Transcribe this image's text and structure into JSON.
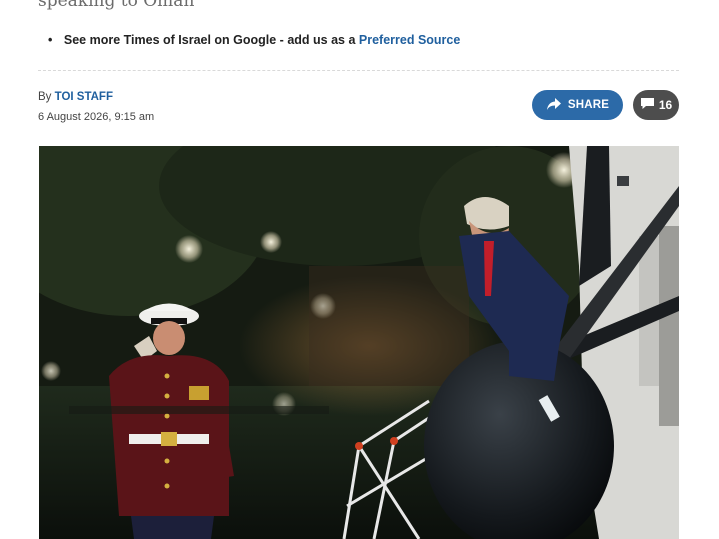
{
  "article": {
    "headline_tail": "speaking to Oman",
    "google_note": {
      "prefix": "See more Times of Israel on Google - add us as a",
      "link_label": "Preferred Source"
    },
    "byline": {
      "prefix": "By",
      "author": "TOI STAFF"
    },
    "dateline": "6 August 2026, 9:15 am"
  },
  "actions": {
    "share_label": "SHARE",
    "comment_count": "16"
  },
  "icons": {
    "share": "share-arrow-icon",
    "comments": "comment-bubble-icon"
  },
  "colors": {
    "link": "#1f5f9e",
    "share_bg": "#2c6aa8",
    "comments_bg": "#4d4d4d"
  }
}
